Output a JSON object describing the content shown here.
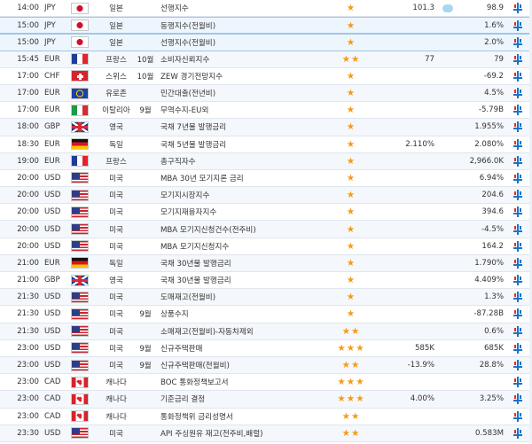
{
  "rows": [
    {
      "time": "14:00",
      "currency": "JPY",
      "flag": "flag-japan-icon",
      "flag_class": "f-jp",
      "country": "일본",
      "period": "",
      "event": "선행지수",
      "importance": "★",
      "actual": "101.3",
      "forecast_icon": "speech-bubble-icon",
      "previous": "98.9"
    },
    {
      "time": "15:00",
      "currency": "JPY",
      "flag": "flag-japan-icon",
      "flag_class": "f-jp",
      "country": "일본",
      "period": "",
      "event": "동행지수(전월비)",
      "importance": "★",
      "actual": "",
      "forecast_icon": "",
      "previous": "1.6%"
    },
    {
      "time": "15:00",
      "currency": "JPY",
      "flag": "flag-japan-icon",
      "flag_class": "f-jp",
      "country": "일본",
      "period": "",
      "event": "선행지수(전월비)",
      "importance": "★",
      "actual": "",
      "forecast_icon": "",
      "previous": "2.0%"
    },
    {
      "time": "15:45",
      "currency": "EUR",
      "flag": "flag-france-icon",
      "flag_class": "f-fr",
      "country": "프랑스",
      "period": "10월",
      "event": "소비자신뢰지수",
      "importance": "★★",
      "actual": "77",
      "forecast_icon": "",
      "previous": "79"
    },
    {
      "time": "17:00",
      "currency": "CHF",
      "flag": "flag-switzerland-icon",
      "flag_class": "f-ch",
      "country": "스위스",
      "period": "10월",
      "event": "ZEW 경기전망지수",
      "importance": "★",
      "actual": "",
      "forecast_icon": "",
      "previous": "-69.2"
    },
    {
      "time": "17:00",
      "currency": "EUR",
      "flag": "flag-eu-icon",
      "flag_class": "f-eu",
      "country": "유로존",
      "period": "",
      "event": "민간대출(전년비)",
      "importance": "★",
      "actual": "",
      "forecast_icon": "",
      "previous": "4.5%"
    },
    {
      "time": "17:00",
      "currency": "EUR",
      "flag": "flag-italy-icon",
      "flag_class": "f-it",
      "country": "이탈리아",
      "period": "9월",
      "event": "무역수지-EU외",
      "importance": "★",
      "actual": "",
      "forecast_icon": "",
      "previous": "-5.79B"
    },
    {
      "time": "18:00",
      "currency": "GBP",
      "flag": "flag-uk-icon",
      "flag_class": "f-gb",
      "country": "영국",
      "period": "",
      "event": "국채 7년물 발행금리",
      "importance": "★",
      "actual": "",
      "forecast_icon": "",
      "previous": "1.955%"
    },
    {
      "time": "18:30",
      "currency": "EUR",
      "flag": "flag-germany-icon",
      "flag_class": "f-de",
      "country": "독일",
      "period": "",
      "event": "국채 5년물 발행금리",
      "importance": "★",
      "actual": "2.110%",
      "forecast_icon": "",
      "previous": "2.080%"
    },
    {
      "time": "19:00",
      "currency": "EUR",
      "flag": "flag-france-icon",
      "flag_class": "f-fr",
      "country": "프랑스",
      "period": "",
      "event": "총구직자수",
      "importance": "★",
      "actual": "",
      "forecast_icon": "",
      "previous": "2,966.0K"
    },
    {
      "time": "20:00",
      "currency": "USD",
      "flag": "flag-usa-icon",
      "flag_class": "f-us",
      "country": "미국",
      "period": "",
      "event": "MBA 30년 모기지론 금리",
      "importance": "★",
      "actual": "",
      "forecast_icon": "",
      "previous": "6.94%"
    },
    {
      "time": "20:00",
      "currency": "USD",
      "flag": "flag-usa-icon",
      "flag_class": "f-us",
      "country": "미국",
      "period": "",
      "event": "모기지시장지수",
      "importance": "★",
      "actual": "",
      "forecast_icon": "",
      "previous": "204.6"
    },
    {
      "time": "20:00",
      "currency": "USD",
      "flag": "flag-usa-icon",
      "flag_class": "f-us",
      "country": "미국",
      "period": "",
      "event": "모기지재융자지수",
      "importance": "★",
      "actual": "",
      "forecast_icon": "",
      "previous": "394.6"
    },
    {
      "time": "20:00",
      "currency": "USD",
      "flag": "flag-usa-icon",
      "flag_class": "f-us",
      "country": "미국",
      "period": "",
      "event": "MBA 모기지신청건수(전주비)",
      "importance": "★",
      "actual": "",
      "forecast_icon": "",
      "previous": "-4.5%"
    },
    {
      "time": "20:00",
      "currency": "USD",
      "flag": "flag-usa-icon",
      "flag_class": "f-us",
      "country": "미국",
      "period": "",
      "event": "MBA 모기지신청지수",
      "importance": "★",
      "actual": "",
      "forecast_icon": "",
      "previous": "164.2"
    },
    {
      "time": "21:00",
      "currency": "EUR",
      "flag": "flag-germany-icon",
      "flag_class": "f-de",
      "country": "독일",
      "period": "",
      "event": "국채 30년물 발행금리",
      "importance": "★",
      "actual": "",
      "forecast_icon": "",
      "previous": "1.790%"
    },
    {
      "time": "21:00",
      "currency": "GBP",
      "flag": "flag-uk-icon",
      "flag_class": "f-gb",
      "country": "영국",
      "period": "",
      "event": "국채 30년물 발행금리",
      "importance": "★",
      "actual": "",
      "forecast_icon": "",
      "previous": "4.409%"
    },
    {
      "time": "21:30",
      "currency": "USD",
      "flag": "flag-usa-icon",
      "flag_class": "f-us",
      "country": "미국",
      "period": "",
      "event": "도매재고(전월비)",
      "importance": "★",
      "actual": "",
      "forecast_icon": "",
      "previous": "1.3%"
    },
    {
      "time": "21:30",
      "currency": "USD",
      "flag": "flag-usa-icon",
      "flag_class": "f-us",
      "country": "미국",
      "period": "9월",
      "event": "상품수지",
      "importance": "★",
      "actual": "",
      "forecast_icon": "",
      "previous": "-87.28B"
    },
    {
      "time": "21:30",
      "currency": "USD",
      "flag": "flag-usa-icon",
      "flag_class": "f-us",
      "country": "미국",
      "period": "",
      "event": "소매재고(전월비)-자동차제외",
      "importance": "★★",
      "actual": "",
      "forecast_icon": "",
      "previous": "0.6%"
    },
    {
      "time": "23:00",
      "currency": "USD",
      "flag": "flag-usa-icon",
      "flag_class": "f-us",
      "country": "미국",
      "period": "9월",
      "event": "신규주택판매",
      "importance": "★★★",
      "actual": "585K",
      "forecast_icon": "",
      "previous": "685K"
    },
    {
      "time": "23:00",
      "currency": "USD",
      "flag": "flag-usa-icon",
      "flag_class": "f-us",
      "country": "미국",
      "period": "9월",
      "event": "신규주택판매(전월비)",
      "importance": "★★",
      "actual": "-13.9%",
      "forecast_icon": "",
      "previous": "28.8%"
    },
    {
      "time": "23:00",
      "currency": "CAD",
      "flag": "flag-canada-icon",
      "flag_class": "f-ca",
      "country": "캐나다",
      "period": "",
      "event": "BOC 통화정책보고서",
      "importance": "★★★",
      "actual": "",
      "forecast_icon": "",
      "previous": ""
    },
    {
      "time": "23:00",
      "currency": "CAD",
      "flag": "flag-canada-icon",
      "flag_class": "f-ca",
      "country": "캐나다",
      "period": "",
      "event": "기준금리 결정",
      "importance": "★★★",
      "actual": "4.00%",
      "forecast_icon": "",
      "previous": "3.25%"
    },
    {
      "time": "23:00",
      "currency": "CAD",
      "flag": "flag-canada-icon",
      "flag_class": "f-ca",
      "country": "캐나다",
      "period": "",
      "event": "통화정책위 금리성명서",
      "importance": "★★",
      "actual": "",
      "forecast_icon": "",
      "previous": ""
    },
    {
      "time": "23:30",
      "currency": "USD",
      "flag": "flag-usa-icon",
      "flag_class": "f-us",
      "country": "미국",
      "period": "",
      "event": "API 주싱원유 재고(전주비,배럴)",
      "importance": "★★",
      "actual": "",
      "forecast_icon": "",
      "previous": "0.583M"
    }
  ]
}
